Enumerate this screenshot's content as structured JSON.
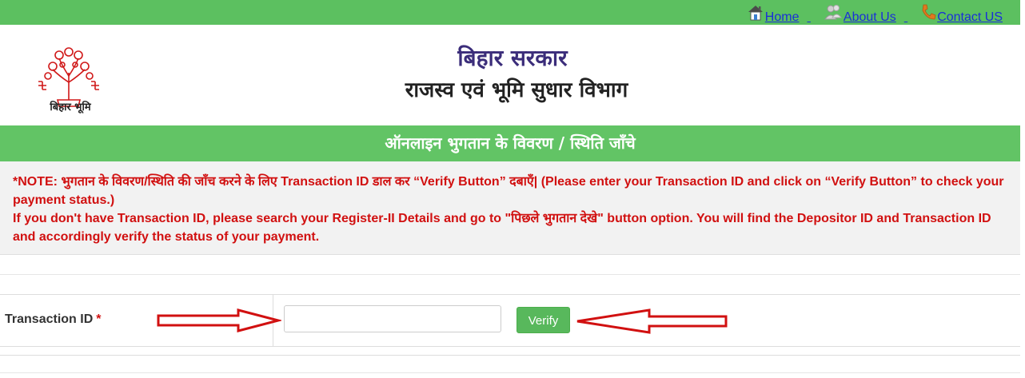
{
  "nav": {
    "home": "Home",
    "about": "About Us",
    "contact": "Contact US"
  },
  "header": {
    "logo_text": "बिहार भूमि",
    "title_line1": "बिहार सरकार",
    "title_line2": "राजस्व एवं भूमि सुधार विभाग"
  },
  "banner": {
    "title": "ऑनलाइन भुगतान के विवरण / स्थिति जाँचे"
  },
  "notice": {
    "line1": "*NOTE: भुगतान के विवरण/स्थिति की जाँच करने के लिए Transaction ID डाल कर “Verify Button” दबाएँ| (Please enter your Transaction ID and click on “Verify Button” to check your payment status.)",
    "line2": "If you don't have Transaction ID, please search your Register-II Details and go to \"पिछले भुगतान देखे\" button option. You will find the Depositor ID and Transaction ID and accordingly verify the status of your payment."
  },
  "form": {
    "transaction_label": "Transaction ID",
    "required_mark": "*",
    "transaction_value": "",
    "verify_label": "Verify"
  },
  "colors": {
    "green_bar": "#5cc060",
    "banner": "#62c465",
    "notice_text": "#d11010",
    "link": "#1a2fd8",
    "arrow": "#d11010"
  },
  "icons": [
    "home-icon",
    "users-icon",
    "phone-icon",
    "emblem-logo",
    "left-pointing-arrow",
    "right-pointing-arrow"
  ]
}
